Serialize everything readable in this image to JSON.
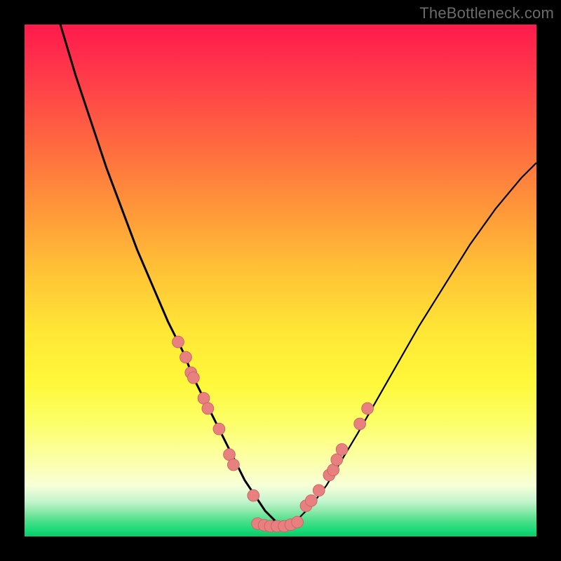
{
  "watermark": "TheBottleneck.com",
  "colors": {
    "background": "#000000",
    "curve": "#000000",
    "dot_fill": "#e98080",
    "dot_stroke": "#c46464"
  },
  "chart_data": {
    "type": "line",
    "title": "",
    "xlabel": "",
    "ylabel": "",
    "xlim": [
      0,
      100
    ],
    "ylim": [
      0,
      100
    ],
    "curve": {
      "x": [
        7,
        10,
        13,
        16,
        19,
        22,
        25,
        28,
        31,
        33,
        35,
        37,
        39,
        41,
        43,
        45,
        47,
        49,
        51,
        53,
        56,
        59,
        62,
        65,
        69,
        73,
        77,
        82,
        87,
        92,
        97,
        100
      ],
      "y": [
        100,
        90,
        81,
        72,
        64,
        56,
        49,
        42,
        36,
        31,
        27,
        23,
        19,
        15,
        11,
        8,
        5,
        3,
        2,
        3,
        6,
        10,
        15,
        20,
        27,
        34,
        41,
        49,
        57,
        64,
        70,
        73
      ]
    },
    "series": [
      {
        "name": "dots-left",
        "x": [
          30.0,
          31.5,
          32.5,
          33.0,
          35.0,
          35.8,
          38.0,
          40.0,
          40.8,
          44.7
        ],
        "y": [
          38,
          35,
          32,
          31,
          27,
          25,
          21,
          16,
          14,
          8
        ]
      },
      {
        "name": "dots-bottom",
        "x": [
          45.5,
          46.8,
          48.0,
          49.3,
          50.7,
          52.0,
          53.3
        ],
        "y": [
          2.5,
          2.2,
          2.0,
          2.0,
          2.0,
          2.3,
          2.8
        ]
      },
      {
        "name": "dots-right",
        "x": [
          55.0,
          56.0,
          57.5,
          59.5,
          60.3,
          61.0,
          62.0,
          65.5,
          67.0
        ],
        "y": [
          6,
          7,
          9,
          12,
          13,
          15,
          17,
          22,
          25
        ]
      }
    ]
  }
}
